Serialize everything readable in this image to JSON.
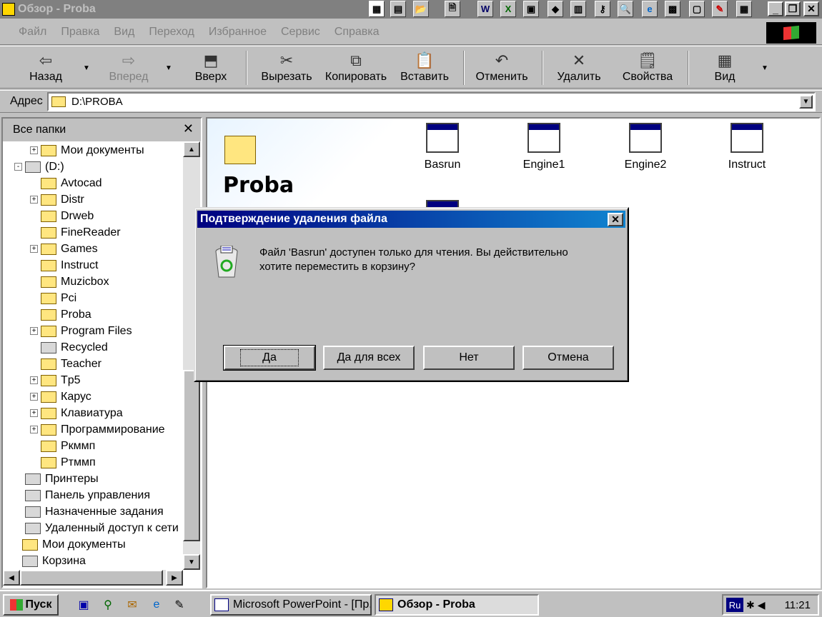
{
  "window": {
    "title": "Обзор - Proba"
  },
  "menu": [
    "Файл",
    "Правка",
    "Вид",
    "Переход",
    "Избранное",
    "Сервис",
    "Справка"
  ],
  "toolbar": {
    "back": "Назад",
    "forward": "Вперед",
    "up": "Вверх",
    "cut": "Вырезать",
    "copy": "Копировать",
    "paste": "Вставить",
    "undo": "Отменить",
    "delete": "Удалить",
    "properties": "Свойства",
    "view": "Вид"
  },
  "address": {
    "label": "Адрес",
    "value": "D:\\PROBA"
  },
  "folders_pane": {
    "title": "Все папки",
    "items": [
      {
        "label": "Мои документы",
        "expander": "+"
      },
      {
        "label": "(D:)",
        "expander": "-"
      },
      {
        "label": "Avtocad",
        "expander": ""
      },
      {
        "label": "Distr",
        "expander": "+"
      },
      {
        "label": "Drweb",
        "expander": ""
      },
      {
        "label": "FineReader",
        "expander": ""
      },
      {
        "label": "Games",
        "expander": "+"
      },
      {
        "label": "Instruct",
        "expander": ""
      },
      {
        "label": "Muzicbox",
        "expander": ""
      },
      {
        "label": "Pci",
        "expander": ""
      },
      {
        "label": "Proba",
        "expander": ""
      },
      {
        "label": "Program Files",
        "expander": "+"
      },
      {
        "label": "Recycled",
        "expander": ""
      },
      {
        "label": "Teacher",
        "expander": ""
      },
      {
        "label": "Tp5",
        "expander": "+"
      },
      {
        "label": "Карус",
        "expander": "+"
      },
      {
        "label": "Клавиатура",
        "expander": "+"
      },
      {
        "label": "Программирование",
        "expander": "+"
      },
      {
        "label": "Ркммп",
        "expander": ""
      },
      {
        "label": "Ртммп",
        "expander": ""
      },
      {
        "label": "Принтеры",
        "expander": ""
      },
      {
        "label": "Панель управления",
        "expander": ""
      },
      {
        "label": "Назначенные задания",
        "expander": ""
      },
      {
        "label": "Удаленный доступ к сети",
        "expander": ""
      },
      {
        "label": "Мои документы",
        "expander": ""
      },
      {
        "label": "Корзина",
        "expander": ""
      }
    ]
  },
  "content": {
    "folder_title": "Proba",
    "files": [
      "Basrun",
      "Engine1",
      "Engine2",
      "Instruct"
    ]
  },
  "dialog": {
    "title": "Подтверждение удаления файла",
    "message": "Файл 'Basrun' доступен только для чтения. Вы действительно хотите переместить в корзину?",
    "buttons": {
      "yes": "Да",
      "yes_all": "Да для всех",
      "no": "Нет",
      "cancel": "Отмена"
    }
  },
  "taskbar": {
    "start": "Пуск",
    "tasks": [
      "Microsoft PowerPoint - [Пр...",
      "Обзор - Proba"
    ],
    "lang": "Ru",
    "clock": "11:21"
  }
}
